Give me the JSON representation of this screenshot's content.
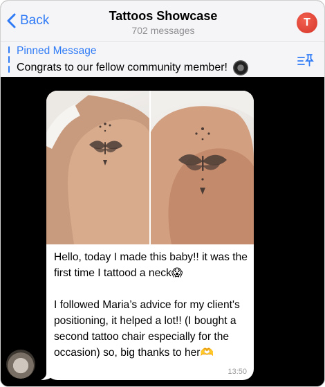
{
  "nav": {
    "back_label": "Back",
    "title": "Tattoos Showcase",
    "subtitle": "702 messages",
    "avatar_letter": "T"
  },
  "pinned": {
    "label": "Pinned Message",
    "text": "Congrats to our fellow community member!"
  },
  "message": {
    "paragraph1": "Hello, today I made this baby!! it was the first time I tattood a neck😱",
    "paragraph2": "I followed Maria’s advice for my client's positioning, it helped a lot!! (I bought a second tattoo chair especially for the occasion) so, big thanks to her🫶",
    "time": "13:50"
  },
  "colors": {
    "accent": "#2f7bf6",
    "chat_background": "#000000",
    "bubble": "#ffffff",
    "avatar": "#e0433a"
  },
  "icons": [
    "chevron-left-icon",
    "pin-list-icon"
  ]
}
